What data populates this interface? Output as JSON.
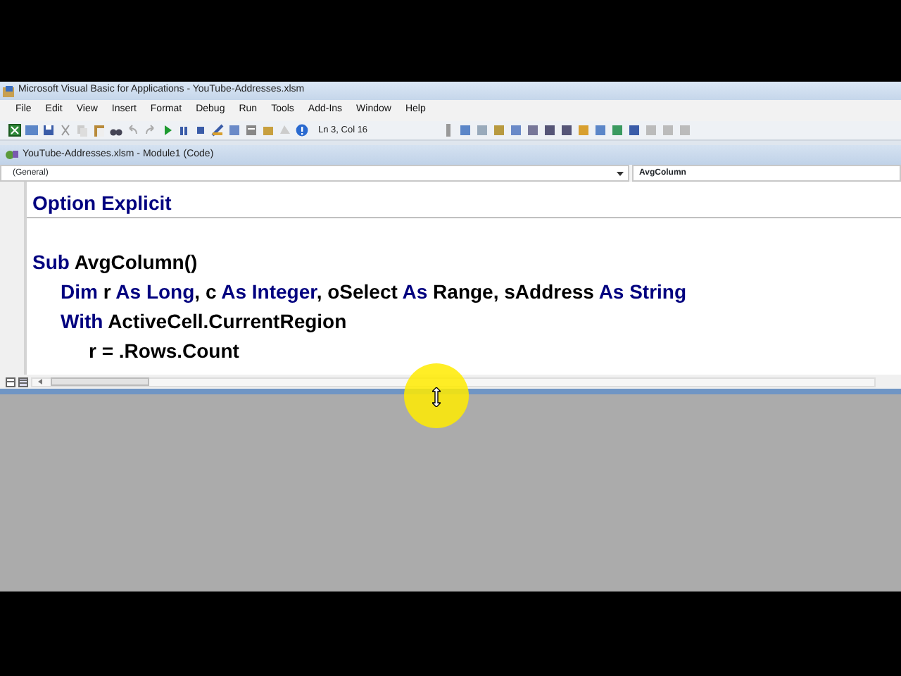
{
  "window": {
    "title": "Microsoft Visual Basic for Applications - YouTube-Addresses.xlsm"
  },
  "menu": [
    "File",
    "Edit",
    "View",
    "Insert",
    "Format",
    "Debug",
    "Run",
    "Tools",
    "Add-Ins",
    "Window",
    "Help"
  ],
  "toolbar": {
    "position": "Ln 3, Col 16"
  },
  "code_window": {
    "title": "YouTube-Addresses.xlsm - Module1 (Code)",
    "object": "(General)",
    "procedure": "AvgColumn",
    "lines": [
      {
        "separator": true,
        "segments": [
          {
            "kind": "keyword",
            "text": "Option Explicit"
          }
        ]
      },
      {
        "separator": false,
        "segments": [
          {
            "kind": "keyword",
            "text": "Sub"
          },
          {
            "kind": "text",
            "text": " AvgColumn()"
          }
        ],
        "children": [
          {
            "segments": [
              {
                "kind": "keyword",
                "text": "Dim"
              },
              {
                "kind": "text",
                "text": " r "
              },
              {
                "kind": "keyword",
                "text": "As Long"
              },
              {
                "kind": "text",
                "text": ", c "
              },
              {
                "kind": "keyword",
                "text": "As Integer"
              },
              {
                "kind": "text",
                "text": ", oSelect "
              },
              {
                "kind": "keyword",
                "text": "As"
              },
              {
                "kind": "text",
                "text": " Range, sAddress "
              },
              {
                "kind": "keyword",
                "text": "As String"
              }
            ]
          },
          {
            "segments": [
              {
                "kind": "keyword",
                "text": "With"
              },
              {
                "kind": "text",
                "text": " ActiveCell.CurrentRegion"
              }
            ],
            "children": [
              {
                "segments": [
                  {
                    "kind": "text",
                    "text": "r = .Rows.Count"
                  }
                ]
              }
            ]
          }
        ]
      }
    ]
  }
}
